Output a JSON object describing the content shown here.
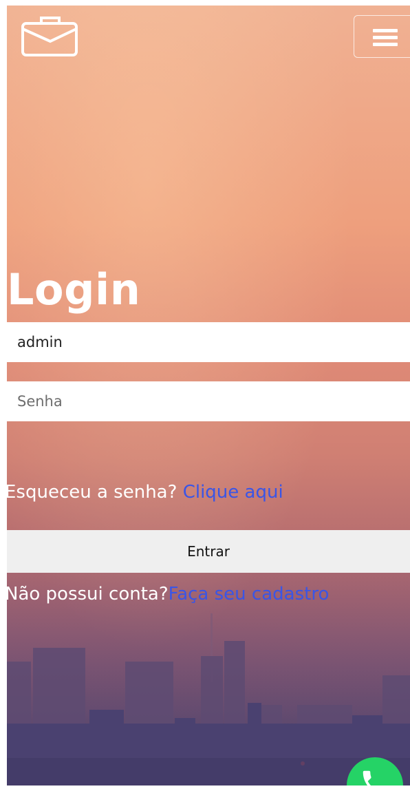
{
  "header": {
    "brand_icon": "briefcase-icon",
    "menu_icon": "hamburger-icon"
  },
  "login": {
    "title": "Login",
    "username_value": "admin",
    "password_placeholder": "Senha",
    "forgot_text": "Esqueceu a senha? ",
    "forgot_link": "Clique aqui",
    "submit_label": "Entrar",
    "signup_text": "Não possui conta?",
    "signup_link": "Faça seu cadastro"
  },
  "floating": {
    "icon": "whatsapp-phone-icon",
    "color": "#25d366"
  },
  "colors": {
    "link": "#3a55e6",
    "text": "#ffffff"
  }
}
